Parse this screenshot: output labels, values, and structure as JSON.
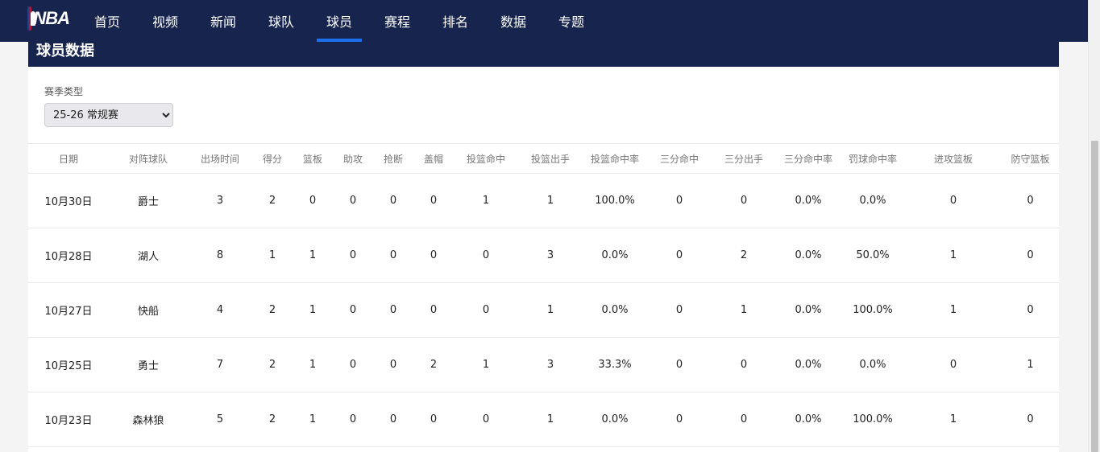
{
  "nav": {
    "logo": "NBA",
    "items": [
      "首页",
      "视频",
      "新闻",
      "球队",
      "球员",
      "赛程",
      "排名",
      "数据",
      "专题"
    ],
    "active_index": 4
  },
  "card": {
    "title": "球员数据",
    "filter_label": "赛季类型",
    "season_selected": "25-26 常规赛"
  },
  "table": {
    "headers": [
      "日期",
      "对阵球队",
      "出场时间",
      "得分",
      "篮板",
      "助攻",
      "抢断",
      "盖帽",
      "投篮命中",
      "投篮出手",
      "投篮命中率",
      "三分命中",
      "三分出手",
      "三分命中率",
      "罚球命中率",
      "进攻篮板",
      "防守篮板"
    ],
    "rows": [
      [
        "10月30日",
        "爵士",
        "3",
        "2",
        "0",
        "0",
        "0",
        "0",
        "1",
        "1",
        "100.0%",
        "0",
        "0",
        "0.0%",
        "0.0%",
        "0",
        "0"
      ],
      [
        "10月28日",
        "湖人",
        "8",
        "1",
        "1",
        "0",
        "0",
        "0",
        "0",
        "3",
        "0.0%",
        "0",
        "2",
        "0.0%",
        "50.0%",
        "1",
        "0"
      ],
      [
        "10月27日",
        "快船",
        "4",
        "2",
        "1",
        "0",
        "0",
        "0",
        "0",
        "1",
        "0.0%",
        "0",
        "1",
        "0.0%",
        "100.0%",
        "1",
        "0"
      ],
      [
        "10月25日",
        "勇士",
        "7",
        "2",
        "1",
        "0",
        "0",
        "2",
        "1",
        "3",
        "33.3%",
        "0",
        "0",
        "0.0%",
        "0.0%",
        "0",
        "1"
      ],
      [
        "10月23日",
        "森林狼",
        "5",
        "2",
        "1",
        "0",
        "0",
        "0",
        "0",
        "1",
        "0.0%",
        "0",
        "0",
        "0.0%",
        "100.0%",
        "1",
        "0"
      ]
    ]
  },
  "colors": {
    "nav_bg": "#17254e",
    "active_underline": "#1e6ff0"
  }
}
